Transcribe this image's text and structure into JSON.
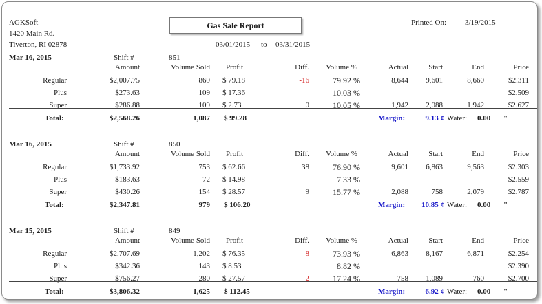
{
  "company": {
    "name": "AGKSoft",
    "address1": "1420 Main Rd.",
    "address2": "Tiverton, RI 02878"
  },
  "report": {
    "title": "Gas Sale Report",
    "printed_label": "Printed On:",
    "printed_date": "3/19/2015",
    "date_from": "03/01/2015",
    "date_to_label": "to",
    "date_to": "03/31/2015"
  },
  "columns": {
    "amount": "Amount",
    "volume_sold": "Volume Sold",
    "profit": "Profit",
    "diff": "Diff.",
    "volume_pct": "Volume %",
    "actual": "Actual",
    "start": "Start",
    "end": "End",
    "price": "Price"
  },
  "labels": {
    "shift": "Shift #",
    "total": "Total:",
    "margin": "Margin:",
    "water": "Water:",
    "inch": "\""
  },
  "shifts": [
    {
      "date": "Mar 16, 2015",
      "shift_no": "851",
      "rows": [
        {
          "grade": "Regular",
          "amount": "$2,007.75",
          "volume": "869",
          "profit": "$ 79.18",
          "diff": "-16",
          "diff_neg": true,
          "volpct": "79.92 %",
          "actual": "8,644",
          "start": "9,601",
          "end": "8,660",
          "price": "$2.311"
        },
        {
          "grade": "Plus",
          "amount": "$273.63",
          "volume": "109",
          "profit": "$ 17.36",
          "diff": "",
          "diff_neg": false,
          "volpct": "10.03 %",
          "actual": "",
          "start": "",
          "end": "",
          "price": "$2.509"
        },
        {
          "grade": "Super",
          "amount": "$286.88",
          "volume": "109",
          "profit": "$ 2.73",
          "diff": "0",
          "diff_neg": false,
          "volpct": "10.05 %",
          "actual": "1,942",
          "start": "2,088",
          "end": "1,942",
          "price": "$2.627"
        }
      ],
      "total": {
        "amount": "$2,568.26",
        "volume": "1,087",
        "profit": "$ 99.28",
        "margin": "9.13 ¢",
        "water": "0.00"
      }
    },
    {
      "date": "Mar 16, 2015",
      "shift_no": "850",
      "rows": [
        {
          "grade": "Regular",
          "amount": "$1,733.92",
          "volume": "753",
          "profit": "$ 62.66",
          "diff": "38",
          "diff_neg": false,
          "volpct": "76.90 %",
          "actual": "9,601",
          "start": "6,863",
          "end": "9,563",
          "price": "$2.303"
        },
        {
          "grade": "Plus",
          "amount": "$183.63",
          "volume": "72",
          "profit": "$ 14.98",
          "diff": "",
          "diff_neg": false,
          "volpct": "7.33 %",
          "actual": "",
          "start": "",
          "end": "",
          "price": "$2.559"
        },
        {
          "grade": "Super",
          "amount": "$430.26",
          "volume": "154",
          "profit": "$ 28.57",
          "diff": "9",
          "diff_neg": false,
          "volpct": "15.77 %",
          "actual": "2,088",
          "start": "758",
          "end": "2,079",
          "price": "$2.787"
        }
      ],
      "total": {
        "amount": "$2,347.81",
        "volume": "979",
        "profit": "$ 106.20",
        "margin": "10.85 ¢",
        "water": "0.00"
      }
    },
    {
      "date": "Mar 15, 2015",
      "shift_no": "849",
      "rows": [
        {
          "grade": "Regular",
          "amount": "$2,707.69",
          "volume": "1,202",
          "profit": "$ 76.35",
          "diff": "-8",
          "diff_neg": true,
          "volpct": "73.93 %",
          "actual": "6,863",
          "start": "8,167",
          "end": "6,871",
          "price": "$2.254"
        },
        {
          "grade": "Plus",
          "amount": "$342.36",
          "volume": "143",
          "profit": "$ 8.53",
          "diff": "",
          "diff_neg": false,
          "volpct": "8.82 %",
          "actual": "",
          "start": "",
          "end": "",
          "price": "$2.390"
        },
        {
          "grade": "Super",
          "amount": "$756.27",
          "volume": "280",
          "profit": "$ 27.57",
          "diff": "-2",
          "diff_neg": true,
          "volpct": "17.24 %",
          "actual": "758",
          "start": "1,089",
          "end": "760",
          "price": "$2.700"
        }
      ],
      "total": {
        "amount": "$3,806.32",
        "volume": "1,625",
        "profit": "$ 112.45",
        "margin": "6.92 ¢",
        "water": "0.00"
      }
    }
  ]
}
